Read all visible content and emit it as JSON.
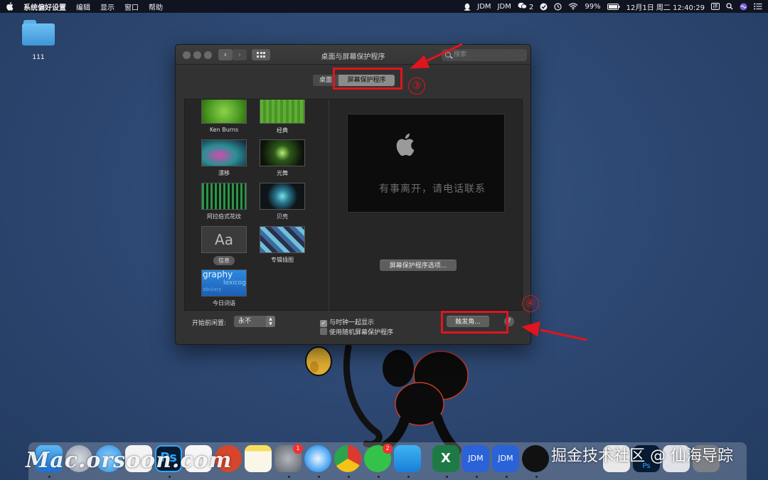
{
  "menubar": {
    "app_name": "系统偏好设置",
    "menus": [
      "编辑",
      "显示",
      "窗口",
      "帮助"
    ],
    "status": {
      "jdm1": "JDM",
      "jdm2": "JDM",
      "wechat_count": "2",
      "battery": "99%",
      "datetime": "12月1日 周二  12:40:29",
      "input_method": "拼"
    }
  },
  "desktop": {
    "folder_label": "111"
  },
  "window": {
    "title": "桌面与屏幕保护程序",
    "search_placeholder": "搜索",
    "tabs": [
      {
        "label": "桌面",
        "selected": false
      },
      {
        "label": "屏幕保护程序",
        "selected": true
      }
    ],
    "savers": [
      {
        "label": "Ken Burns"
      },
      {
        "label": "经典"
      },
      {
        "label": "漂移"
      },
      {
        "label": "光舞"
      },
      {
        "label": "阿拉伯式花纹"
      },
      {
        "label": "贝壳"
      },
      {
        "label": "信息",
        "selected": true
      },
      {
        "label": "专辑插图"
      },
      {
        "label": "今日词语"
      }
    ],
    "info_thumb_text": "Aa",
    "word_thumb_text": {
      "line1": "graphy",
      "line2": "lexicog",
      "line3": "abulary"
    },
    "preview_message": "有事离开，请电话联系",
    "options_button": "屏幕保护程序选项...",
    "start_label": "开始前闲置:",
    "start_value": "永不",
    "show_clock_label": "与时钟一起显示",
    "show_clock_checked": true,
    "random_label": "使用随机屏幕保护程序",
    "random_checked": false,
    "hot_corners_button": "触发角...",
    "help_label": "?"
  },
  "annotations": {
    "step3": "③",
    "step4": "④",
    "color": "#e0151d"
  },
  "dock": {
    "badges": {
      "syspref": "1",
      "wechat": "2"
    },
    "jdm_label": "JDM",
    "excel_label": "X",
    "ps_label": "Ps",
    "ps_small_label": "Ps"
  },
  "watermarks": {
    "left": "Mac.orsoon.com",
    "right": "掘金技术社区 @ 仙海导踪"
  }
}
